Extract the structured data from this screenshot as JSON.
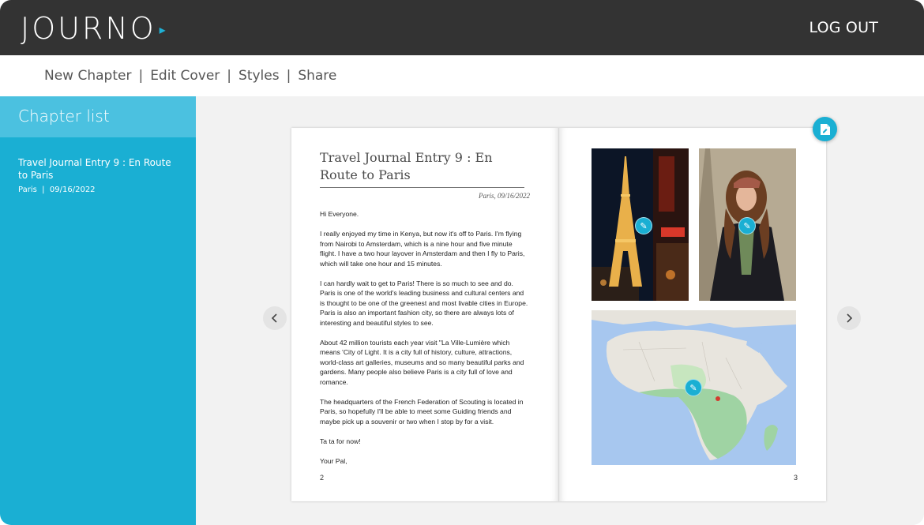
{
  "app": {
    "logo_text": "JOURNO",
    "logout_label": "LOG OUT"
  },
  "toolbar": {
    "items": [
      "New Chapter",
      "Edit Cover",
      "Styles",
      "Share"
    ],
    "separator": "|"
  },
  "sidebar": {
    "heading": "Chapter list",
    "chapters": [
      {
        "title": "Travel Journal Entry 9 : En Route to Paris",
        "location": "Paris",
        "date": "09/16/2022",
        "meta_sep": "|"
      }
    ]
  },
  "book": {
    "left_page": {
      "title": "Travel Journal Entry 9 : En Route to Paris",
      "dateline": "Paris, 09/16/2022",
      "paragraphs": [
        "Hi Everyone.",
        "I really enjoyed my time in Kenya, but now it's off to Paris. I'm flying from Nairobi to Amsterdam, which is a nine hour and five minute flight. I have a two hour layover in Amsterdam and then I fly to Paris, which will take one hour and 15 minutes.",
        "I can hardly wait to get to Paris! There is so much to see and do. Paris is one of the world's leading business and cultural centers and is thought to be one of the greenest and most livable cities in Europe. Paris is also an important fashion city, so there are always lots of interesting and beautiful styles to see.",
        "About 42 million tourists each year visit \"La Ville-Lumière which means 'City of Light. It is a city full of history, culture, attractions, world-class art galleries, museums and so many beautiful parks and gardens. Many people also believe Paris is a city full of love and romance.",
        "The headquarters of the French Federation of Scouting is located in Paris, so hopefully I'll be able to meet some Guiding friends and maybe pick up a souvenir or two when I stop by for a visit.",
        "Ta ta for now!",
        "Your Pal,"
      ],
      "page_number": "2"
    },
    "right_page": {
      "page_number": "3",
      "photos": [
        {
          "subject": "eiffel-tower-night",
          "edit_icon": "pencil-icon"
        },
        {
          "subject": "woman-with-cap",
          "edit_icon": "pencil-icon"
        },
        {
          "subject": "map-of-africa",
          "edit_icon": "pencil-icon"
        }
      ]
    }
  },
  "icons": {
    "doc_button": "document-edit-icon",
    "prev": "chevron-left-icon",
    "next": "chevron-right-icon"
  },
  "colors": {
    "header_bg": "#333333",
    "accent": "#1aafd3",
    "sidebar_head": "#4bc1e0",
    "canvas": "#f2f2f2"
  }
}
